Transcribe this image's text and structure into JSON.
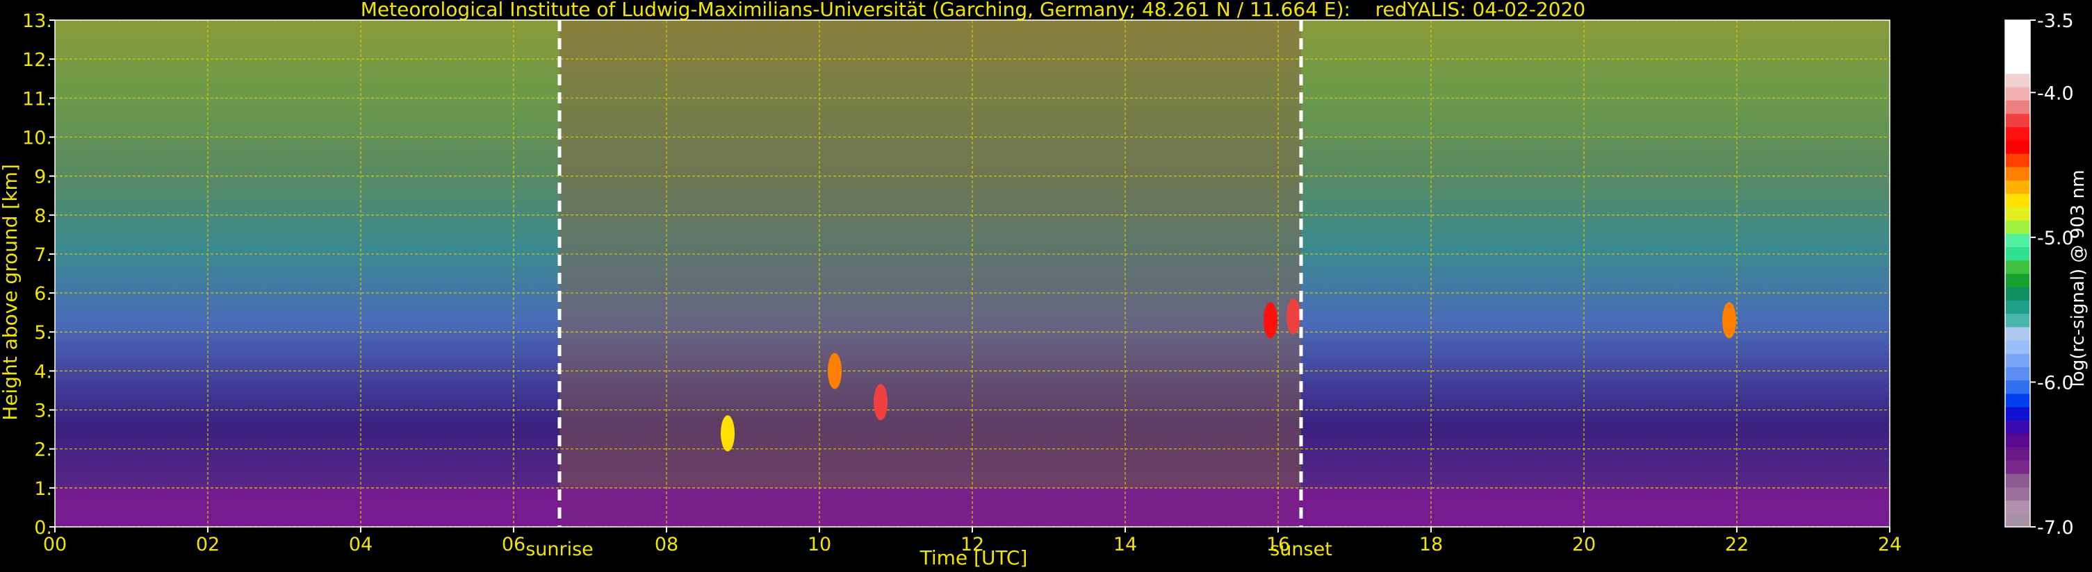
{
  "chart_data": {
    "type": "heatmap",
    "title": "Meteorological Institute of Ludwig-Maximilians-Universität (Garching, Germany; 48.261 N / 11.664 E):    redYALIS: 04-02-2020",
    "xlabel": "Time [UTC]",
    "ylabel": "Height above ground [km]",
    "xlim": [
      0,
      24
    ],
    "ylim": [
      0,
      13
    ],
    "x_ticks": [
      "00",
      "02",
      "04",
      "06",
      "08",
      "10",
      "12",
      "14",
      "16",
      "18",
      "20",
      "22",
      "24"
    ],
    "y_ticks": [
      "0.",
      "1.",
      "2.",
      "3.",
      "4.",
      "5.",
      "6.",
      "7.",
      "8.",
      "9.",
      "10.",
      "11.",
      "12.",
      "13."
    ],
    "grid": true,
    "colorbar": {
      "label": "log(rc-signal) @ 903 nm",
      "range": [
        -7.0,
        -3.5
      ],
      "ticks": [
        "-3.5",
        "-4.0",
        "-5.0",
        "-6.0",
        "-7.0"
      ],
      "colors": [
        "#a892a6",
        "#b090ac",
        "#9c709e",
        "#8a5c90",
        "#7a2a8a",
        "#6a1a88",
        "#5a0a90",
        "#3a0ab0",
        "#1010d0",
        "#0040f0",
        "#3070f0",
        "#5a8ef4",
        "#7aa6f6",
        "#9cbef8",
        "#b0c8f0",
        "#4ab6ae",
        "#20a088",
        "#109060",
        "#18a030",
        "#40c040",
        "#30e090",
        "#50f0a0",
        "#a0f040",
        "#e0f020",
        "#ffe000",
        "#ffb000",
        "#ff8000",
        "#ff4000",
        "#ff0000",
        "#ff1010",
        "#f04040",
        "#f08080",
        "#f0b0b0",
        "#f0d0d0",
        "#ffffff",
        "#ffffff",
        "#ffffff",
        "#ffffff"
      ]
    },
    "markers": [
      {
        "label": "sunrise",
        "x": 6.6
      },
      {
        "label": "sunset",
        "x": 16.3
      }
    ],
    "cloud_base_events": [
      {
        "x": 10.8,
        "y": 3.2,
        "level": -4.2
      },
      {
        "x": 16.2,
        "y": 5.4,
        "level": -4.2
      },
      {
        "x": 15.9,
        "y": 5.3,
        "level": -4.3
      },
      {
        "x": 21.9,
        "y": 5.3,
        "level": -4.6
      },
      {
        "x": 10.2,
        "y": 4.0,
        "level": -4.6
      },
      {
        "x": 8.8,
        "y": 2.4,
        "level": -4.7
      }
    ]
  }
}
